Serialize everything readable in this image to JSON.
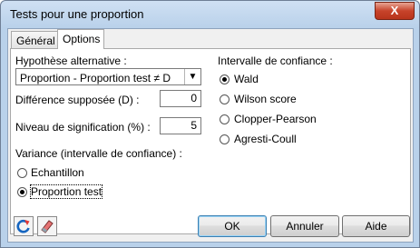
{
  "window": {
    "title": "Tests pour une proportion",
    "close_glyph": "X"
  },
  "tabs": [
    {
      "label": "Général"
    },
    {
      "label": "Options"
    }
  ],
  "options": {
    "alt_hypothesis_label": "Hypothèse alternative :",
    "alt_hypothesis_value": "Proportion - Proportion test ≠ D",
    "difference_label": "Différence supposée (D) :",
    "difference_value": "0",
    "significance_label": "Niveau de signification (%) :",
    "significance_value": "5",
    "variance_label": "Variance (intervalle de confiance) :",
    "variance_options": [
      {
        "label": "Echantillon",
        "selected": false
      },
      {
        "label": "Proportion test",
        "selected": true
      }
    ],
    "ci_label": "Intervalle de confiance :",
    "ci_options": [
      {
        "label": "Wald",
        "selected": true
      },
      {
        "label": "Wilson score",
        "selected": false
      },
      {
        "label": "Clopper-Pearson",
        "selected": false
      },
      {
        "label": "Agresti-Coull",
        "selected": false
      }
    ]
  },
  "footer": {
    "ok": "OK",
    "cancel": "Annuler",
    "help": "Aide",
    "icons": [
      "reset-icon",
      "eraser-icon"
    ]
  }
}
